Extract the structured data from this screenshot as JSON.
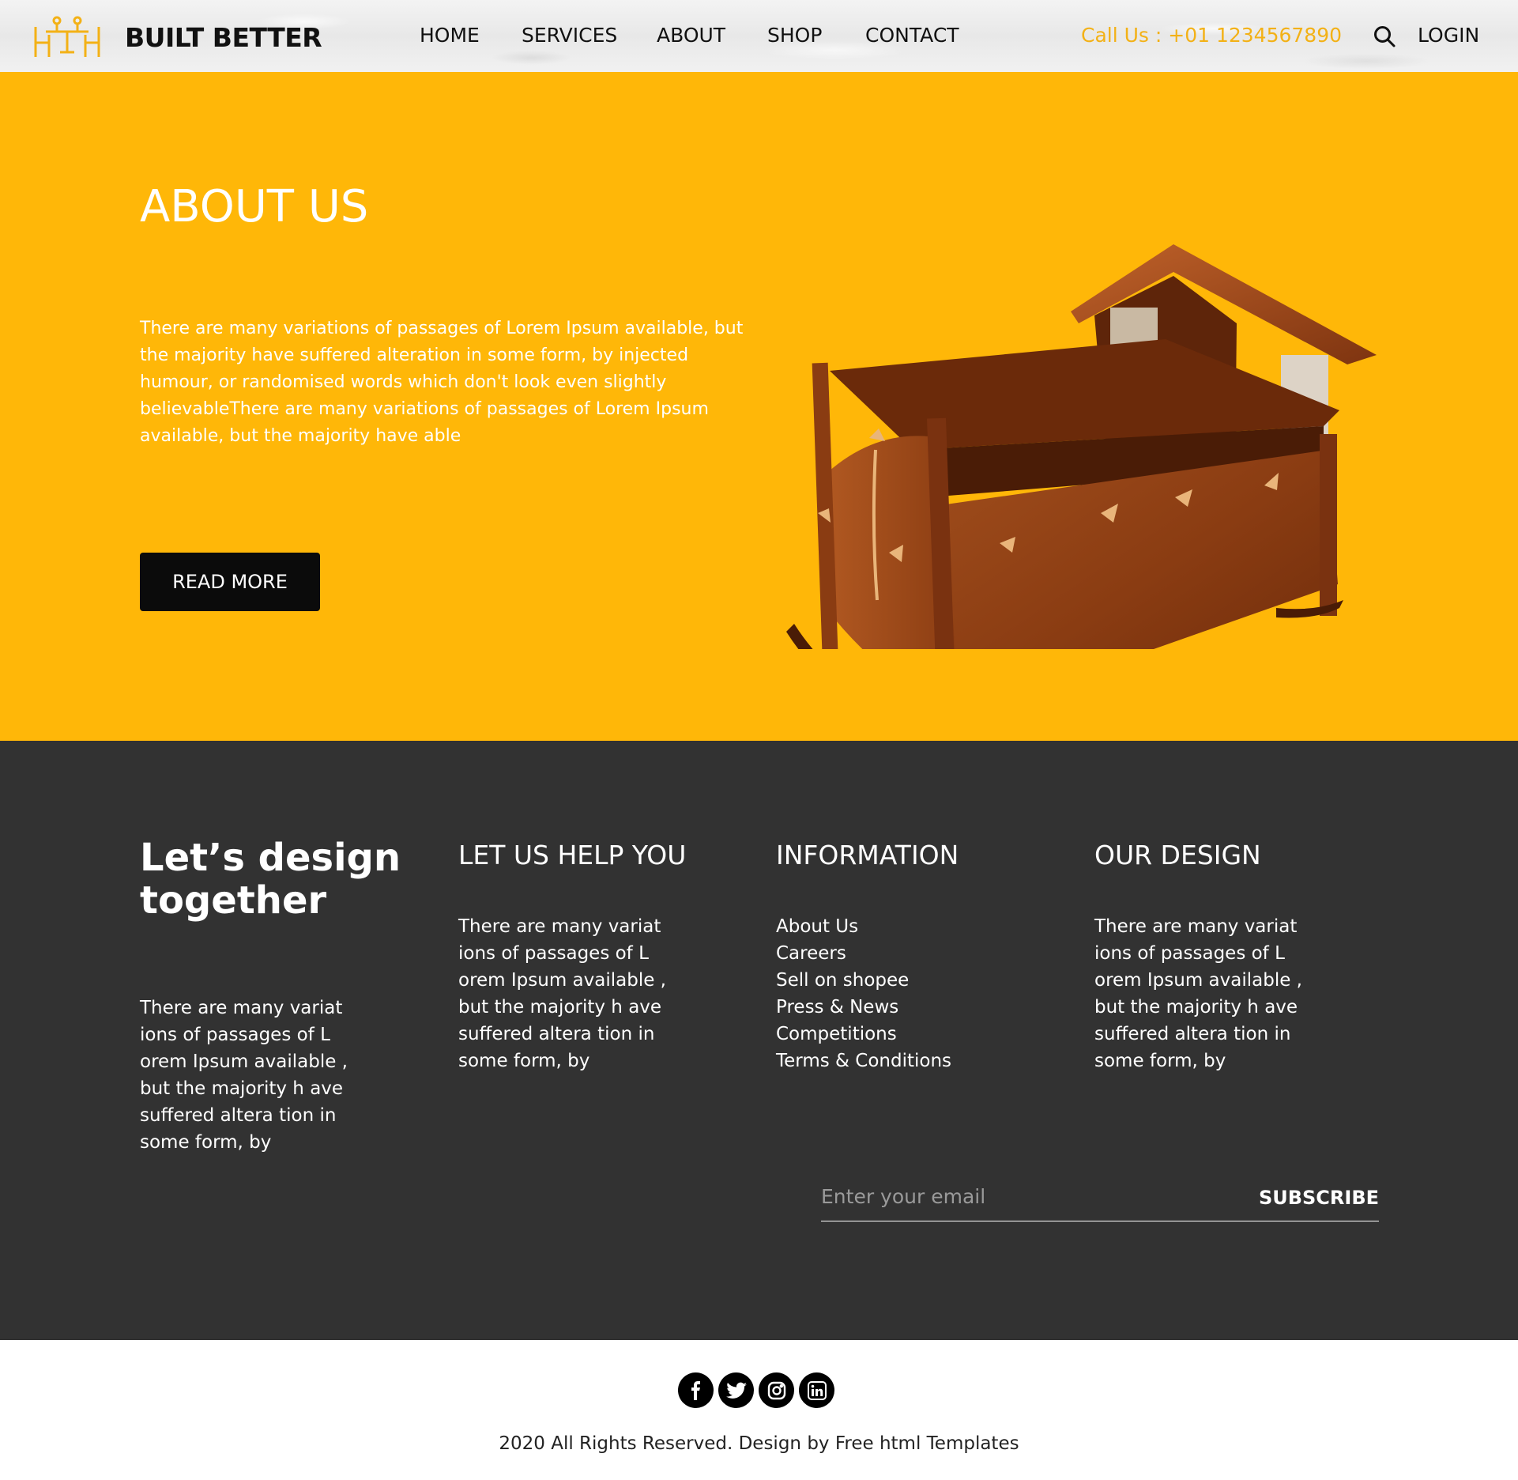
{
  "header": {
    "brand": "BUILT BETTER",
    "nav": [
      {
        "label": "HOME"
      },
      {
        "label": "SERVICES"
      },
      {
        "label": "ABOUT"
      },
      {
        "label": "SHOP"
      },
      {
        "label": "CONTACT"
      }
    ],
    "call": "Call Us : +01 1234567890",
    "login": "LOGIN",
    "search_icon": "search-icon"
  },
  "hero": {
    "title": "ABOUT US",
    "text": "There are many variations of passages of Lorem Ipsum available, but the majority have suffered alteration in some form, by injected humour, or randomised words which don't look even slightly believableThere are many variations of passages of Lorem Ipsum available, but the majority have able",
    "button": "READ MORE"
  },
  "info": {
    "tagline": "Let’s design together",
    "tagline_text": "There are many variat ions of passages of L orem Ipsum available , but the majority h ave suffered altera tion in some form, by",
    "help": {
      "title": "LET US HELP YOU",
      "text": "There are many variat ions of passages of L orem Ipsum available , but the majority h ave suffered altera tion in some form, by"
    },
    "information": {
      "title": "INFORMATION",
      "links": [
        "About Us",
        "Careers",
        "Sell on shopee",
        "Press & News",
        "Competitions",
        "Terms & Conditions"
      ]
    },
    "design": {
      "title": "OUR DESIGN",
      "text": "There are many variat ions of passages of L orem Ipsum available , but the majority h ave suffered altera tion in some form, by"
    },
    "subscribe": {
      "placeholder": "Enter your email",
      "button": "SUBSCRIBE"
    }
  },
  "footer": {
    "socials": [
      "facebook-icon",
      "twitter-icon",
      "instagram-icon",
      "linkedin-icon"
    ],
    "copyright": "2020 All Rights Reserved. Design by Free html Templates"
  },
  "colors": {
    "accent": "#ffb708",
    "dark": "#323232",
    "call": "#f3b116"
  }
}
